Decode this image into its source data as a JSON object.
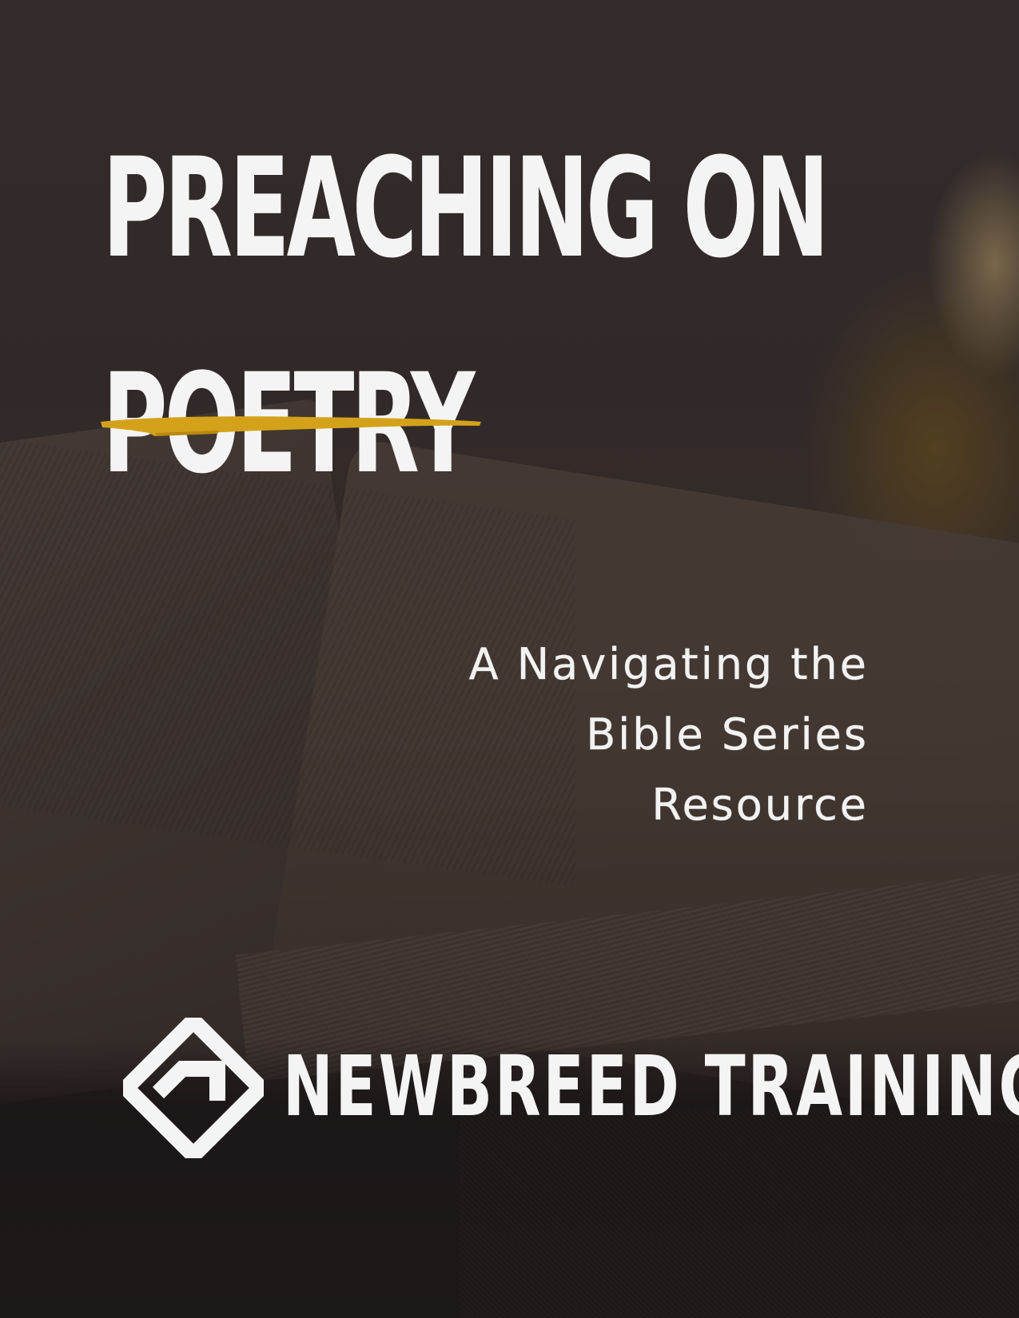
{
  "cover": {
    "title_line_1": "PREACHING ON",
    "title_line_2": "POETRY",
    "subtitle_line_1": "A Navigating the",
    "subtitle_line_2": "Bible Series",
    "subtitle_line_3": "Resource",
    "brand_name": "NEWBREED TRAINING"
  },
  "icons": {
    "logo_mark": "diamond-chevron-logo-icon",
    "underline": "yellow-brush-stroke"
  },
  "colors": {
    "title_text": "#f4f4f4",
    "accent_brush": "#d4a21a",
    "background_dark": "#2d2624"
  }
}
